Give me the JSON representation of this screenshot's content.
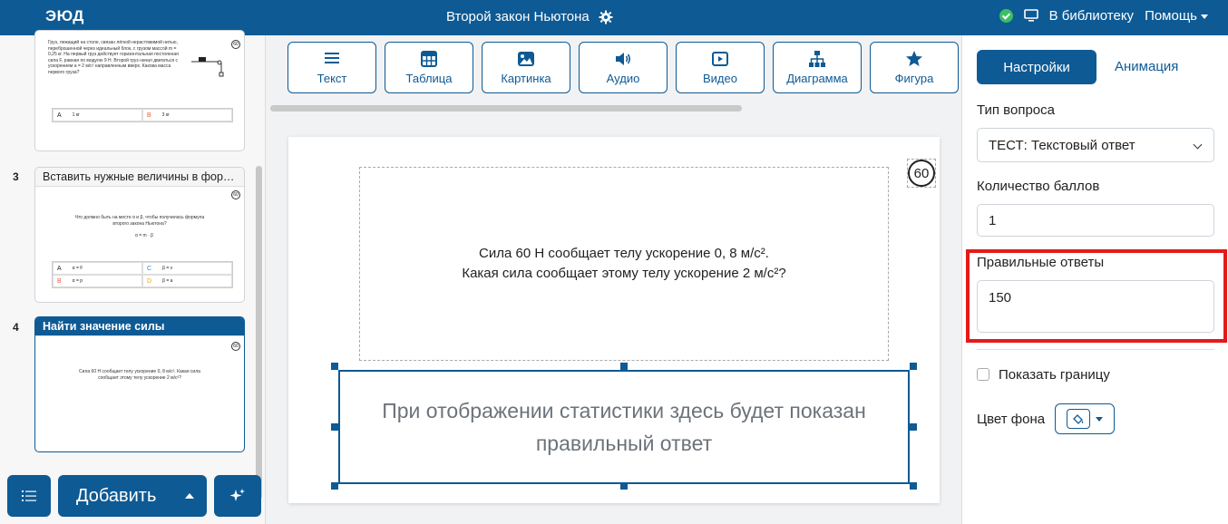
{
  "header": {
    "logo": "ЭЮД",
    "title": "Второй закон Ньютона",
    "library_label": "В библиотеку",
    "help_label": "Помощь"
  },
  "slides": [
    {
      "question": "Груз, лежащий на столе, связан лёгкой нерастяжимой нитью, переброшенной через идеальный блок, с грузом массой m = 0,25 кг. На первый груз действует горизонтальная постоянная сила F, равная по модулю 9 Н. Второй груз начал двигаться с ускорением a = 2 м/с² направленным вверх. Какова масса первого груза?",
      "timer": "60",
      "options": [
        {
          "letter": "A",
          "text": "1 кг"
        },
        {
          "letter": "B",
          "text": "3 кг"
        }
      ]
    },
    {
      "number": "3",
      "title": "Вставить нужные величины в форму...",
      "timer": "60",
      "question": "Что должно быть на месте α и β, чтобы получилась формула второго закона Ньютона?",
      "formula": "α = m · β",
      "options": [
        {
          "letter": "A",
          "text": "α = F"
        },
        {
          "letter": "C",
          "text": "β = v"
        },
        {
          "letter": "B",
          "text": "α = p"
        },
        {
          "letter": "D",
          "text": "β = a"
        }
      ]
    },
    {
      "number": "4",
      "title": "Найти значение силы",
      "timer": "60",
      "question": "Сила 60 Н сообщает телу ускорение 0, 8 м/с². Какая сила сообщает этому телу ускорение 2 м/с²?"
    }
  ],
  "sidebar_buttons": {
    "add_label": "Добавить"
  },
  "toolbar": {
    "items": [
      {
        "label": "Текст",
        "icon": "text-lines-icon"
      },
      {
        "label": "Таблица",
        "icon": "table-icon"
      },
      {
        "label": "Картинка",
        "icon": "image-icon"
      },
      {
        "label": "Аудио",
        "icon": "speaker-icon"
      },
      {
        "label": "Видео",
        "icon": "video-icon"
      },
      {
        "label": "Диаграмма",
        "icon": "diagram-icon"
      },
      {
        "label": "Фигура",
        "icon": "star-icon"
      }
    ]
  },
  "canvas": {
    "timer": "60",
    "question_line1": "Сила 60 Н сообщает телу ускорение 0, 8 м/с².",
    "question_line2": "Какая сила сообщает этому телу ускорение 2 м/с²?",
    "answer_placeholder": "При отображении статистики здесь будет показан правильный ответ"
  },
  "settings": {
    "tab_settings": "Настройки",
    "tab_animation": "Анимация",
    "question_type_label": "Тип вопроса",
    "question_type_value": "ТЕСТ: Текстовый ответ",
    "points_label": "Количество баллов",
    "points_value": "1",
    "correct_answers_label": "Правильные ответы",
    "correct_answers_value": "150",
    "show_border_label": "Показать границу",
    "bg_color_label": "Цвет фона"
  },
  "colors": {
    "brand": "#0e5a94",
    "highlight": "#e41a1a",
    "success": "#3bbf62"
  }
}
